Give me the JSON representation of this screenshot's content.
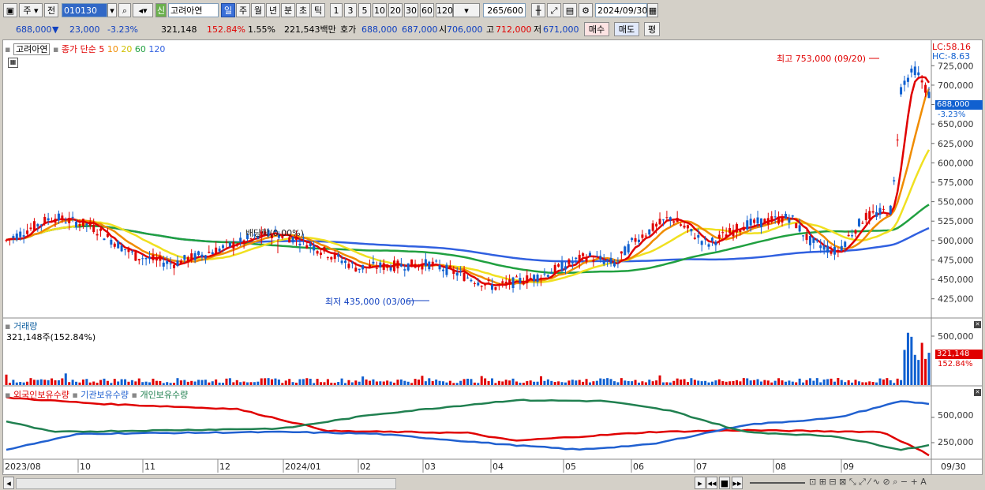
{
  "toolbar": {
    "type_label": "주",
    "all_label": "전",
    "code": "010130",
    "badge": "신",
    "stock_name": "고려아연",
    "periods": [
      "일",
      "주",
      "월",
      "년",
      "분",
      "초",
      "틱"
    ],
    "intervals": [
      "1",
      "3",
      "5",
      "10",
      "20",
      "30",
      "60",
      "120"
    ],
    "count": "265",
    "count_max": "/600",
    "date": "2024/09/30"
  },
  "info": {
    "price": "688,000",
    "arrow": "▼",
    "change": "23,000",
    "change_pct": "-3.23%",
    "volume": "321,148",
    "volume_pct": "152.84%",
    "turnover_pct": "1.55%",
    "amount": "221,543백만",
    "quote_label": "호가",
    "ask": "688,000",
    "bid": "687,000",
    "open_label": "시",
    "open": "706,000",
    "high_label": "고",
    "high": "712,000",
    "low_label": "저",
    "low": "671,000",
    "buy_btn": "매수",
    "sell_btn": "매도",
    "eval_btn": "평"
  },
  "price_panel": {
    "name_tag": "고려아연",
    "ma_label": "종가 단순",
    "ma_periods": [
      "5",
      "10",
      "20",
      "60",
      "120"
    ],
    "lc": "LC:58.16",
    "hc": "HC:-8.63",
    "current": "688,000",
    "current_pct": "-3.23%",
    "high_note": "최고 753,000 (09/20)",
    "low_note": "최저 435,000 (03/06)",
    "dividend_note": "배당락(0.00%)",
    "yticks": [
      "725,000",
      "700,000",
      "675,000",
      "650,000",
      "625,000",
      "600,000",
      "575,000",
      "550,000",
      "525,000",
      "500,000",
      "475,000",
      "450,000",
      "425,000"
    ]
  },
  "volume_panel": {
    "title": "거래량",
    "value": "321,148주(152.84%)",
    "ytick": "500,000",
    "current": "321,148",
    "current_pct": "152.84%"
  },
  "holding_panel": {
    "foreign": "외국인보유수량",
    "inst": "기관보유수량",
    "indiv": "개인보유수량",
    "yticks": [
      "500,000",
      "250,000"
    ]
  },
  "xaxis": [
    "2023/08",
    "10",
    "11",
    "12",
    "2024/01",
    "02",
    "03",
    "04",
    "05",
    "06",
    "07",
    "08",
    "09",
    "09/30"
  ],
  "colors": {
    "up": "#e00000",
    "down": "#1060d0",
    "ma5": "#e00000",
    "ma10": "#f08c00",
    "ma20": "#f0e020",
    "ma60": "#20a040",
    "ma120": "#3060e0"
  }
}
